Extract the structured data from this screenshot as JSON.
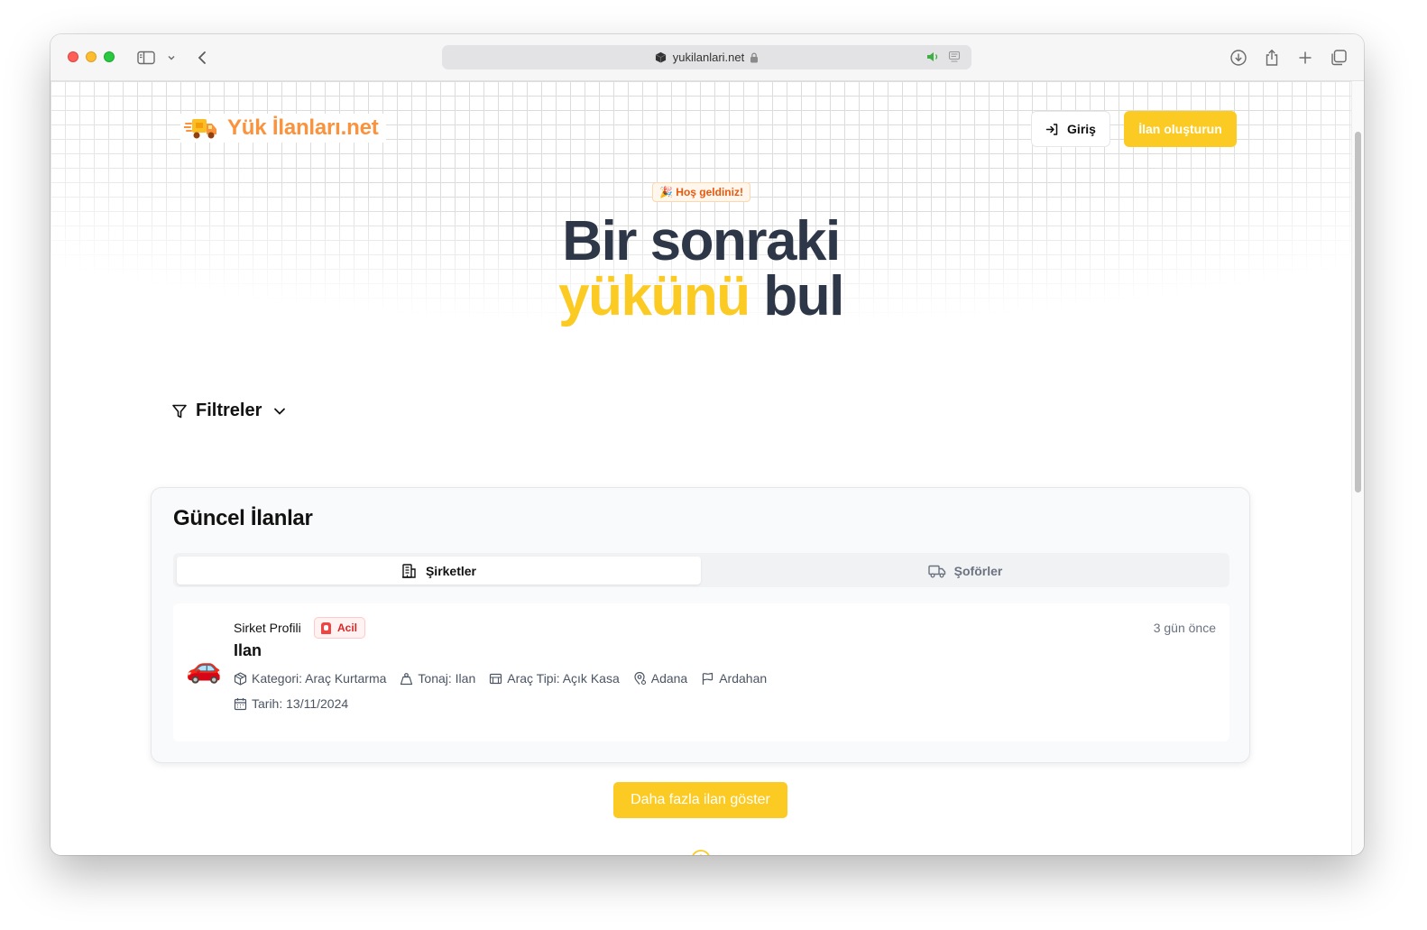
{
  "browser": {
    "url": "yukilanlari.net"
  },
  "header": {
    "logo_text": "Yük İlanları.net",
    "login_label": "Giriş",
    "create_label": "İlan oluşturun"
  },
  "hero": {
    "badge": "🎉 Hoş geldiniz!",
    "line1": "Bir sonraki",
    "line2_highlight": "yükünü",
    "line2_rest": "bul"
  },
  "filters": {
    "label": "Filtreler"
  },
  "listings_card": {
    "title": "Güncel İlanlar",
    "tabs": [
      {
        "label": "Şirketler",
        "active": true
      },
      {
        "label": "Şoförler",
        "active": false
      }
    ],
    "items": [
      {
        "emoji": "🚗",
        "company": "Sirket Profili",
        "badge": "Acil",
        "title": "Ilan",
        "time_ago": "3 gün önce",
        "category": "Kategori: Araç Kurtarma",
        "tonnage": "Tonaj: Ilan",
        "vehicle_type": "Araç Tipi: Açık Kasa",
        "origin": "Adana",
        "destination": "Ardahan",
        "date": "Tarih: 13/11/2024"
      }
    ]
  },
  "more_button_label": "Daha fazla ilan göster",
  "colors": {
    "accent_yellow": "#fbcb24",
    "logo_orange": "#fb923c",
    "heading_dark": "#2d3748",
    "urgent_red": "#dc2626"
  }
}
